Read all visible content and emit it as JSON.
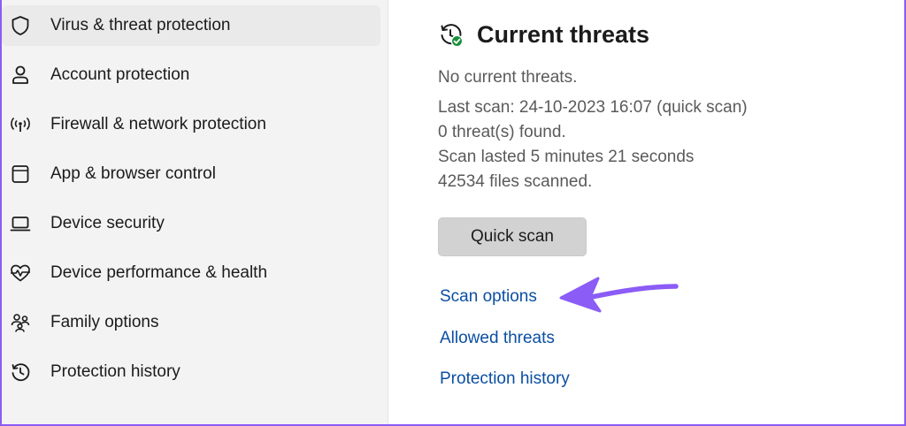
{
  "sidebar": {
    "items": [
      {
        "label": "Virus & threat protection",
        "icon": "shield-icon",
        "selected": true
      },
      {
        "label": "Account protection",
        "icon": "person-icon"
      },
      {
        "label": "Firewall & network protection",
        "icon": "wireless-antenna-icon"
      },
      {
        "label": "App & browser control",
        "icon": "app-window-icon"
      },
      {
        "label": "Device security",
        "icon": "laptop-icon"
      },
      {
        "label": "Device performance & health",
        "icon": "heart-pulse-icon"
      },
      {
        "label": "Family options",
        "icon": "family-icon"
      },
      {
        "label": "Protection history",
        "icon": "history-clock-icon"
      }
    ]
  },
  "main": {
    "heading": "Current threats",
    "heading_icon": "scan-history-check-icon",
    "status": "No current threats.",
    "last_scan": "Last scan: 24-10-2023 16:07 (quick scan)",
    "threats_found": "0 threat(s) found.",
    "scan_duration": "Scan lasted 5 minutes 21 seconds",
    "files_scanned": "42534 files scanned.",
    "quick_scan_label": "Quick scan",
    "links": {
      "scan_options": "Scan options",
      "allowed_threats": "Allowed threats",
      "protection_history": "Protection history"
    }
  },
  "annotation": {
    "arrow_color": "#8b5cf6",
    "points_to": "Scan options"
  },
  "colors": {
    "accent": "#8b5cf6",
    "link": "#0b4fa3",
    "success": "#1a8f3c"
  }
}
